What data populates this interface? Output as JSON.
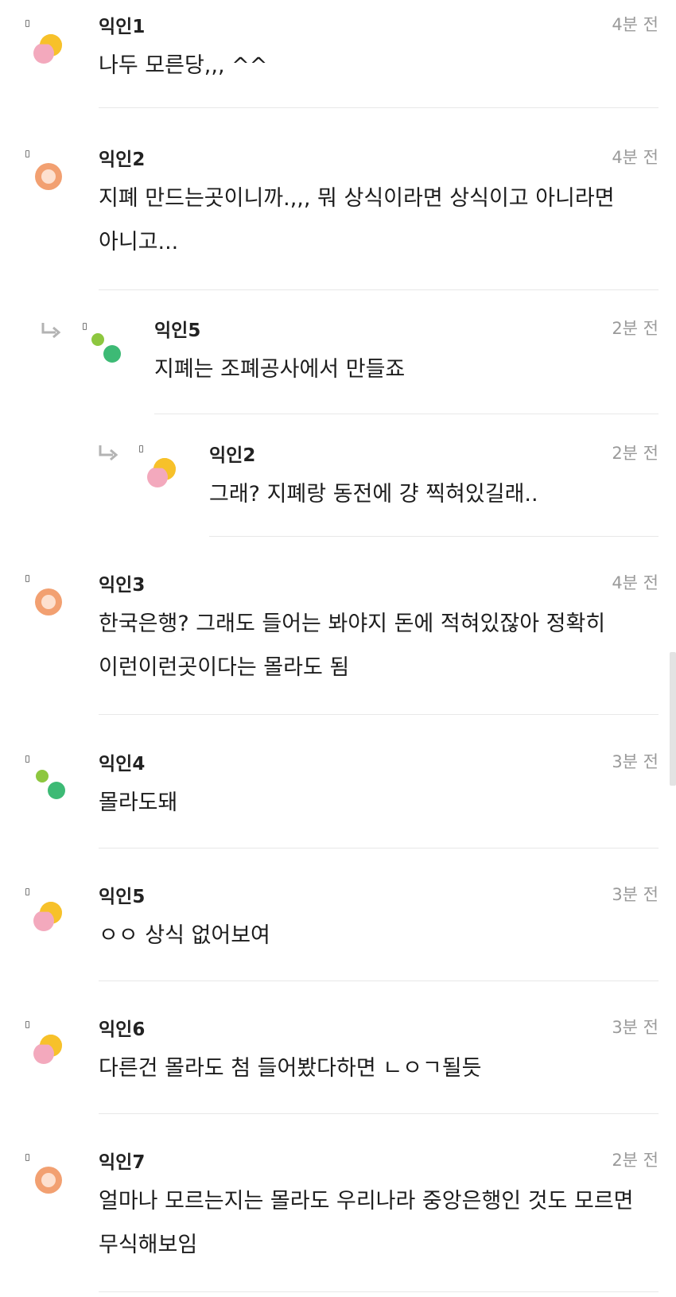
{
  "comments": [
    {
      "author": "익인1",
      "time": "4분 전",
      "text": "나두 모른당,,, ^^",
      "avatar_icon": "sun-cloud-avatar-icon",
      "depth": 0
    },
    {
      "author": "익인2",
      "time": "4분 전",
      "text": "지폐 만드는곳이니까.,,, 뭐 상식이라면 상식이고 아니라면 아니고...",
      "avatar_icon": "donut-avatar-icon",
      "depth": 0
    },
    {
      "author": "익인5",
      "time": "2분 전",
      "text": "지폐는 조폐공사에서 만들죠",
      "avatar_icon": "dots-avatar-icon",
      "depth": 1
    },
    {
      "author": "익인2",
      "time": "2분 전",
      "text": "그래? 지폐랑 동전에 걍 찍혀있길래..",
      "avatar_icon": "sun-cloud-avatar-icon",
      "depth": 2
    },
    {
      "author": "익인3",
      "time": "4분 전",
      "text": "한국은행? 그래도 들어는 봐야지 돈에 적혀있잖아 정확히 이런이런곳이다는 몰라도 됨",
      "avatar_icon": "donut-avatar-icon",
      "depth": 0
    },
    {
      "author": "익인4",
      "time": "3분 전",
      "text": "몰라도돼",
      "avatar_icon": "dots-avatar-icon",
      "depth": 0
    },
    {
      "author": "익인5",
      "time": "3분 전",
      "text": "ㅇㅇ 상식 없어보여",
      "avatar_icon": "sun-cloud-avatar-icon",
      "depth": 0
    },
    {
      "author": "익인6",
      "time": "3분 전",
      "text": "다른건 몰라도 첨 들어봤다하면 ㄴㅇㄱ될듯",
      "avatar_icon": "sun-cloud-avatar-icon",
      "depth": 0
    },
    {
      "author": "익인7",
      "time": "2분 전",
      "text": "얼마나 모르는지는 몰라도 우리나라 중앙은행인 것도 모르면 무식해보임",
      "avatar_icon": "donut-avatar-icon",
      "depth": 0
    }
  ],
  "colors": {
    "sun_yellow": "#f7c12a",
    "cloud_pink": "#f3a9bd",
    "donut_orange": "#f2a071",
    "dot_lime": "#8dc73f",
    "dot_green": "#3dba75",
    "divider": "#e8e8e8",
    "time_gray": "#9a9a9a"
  }
}
